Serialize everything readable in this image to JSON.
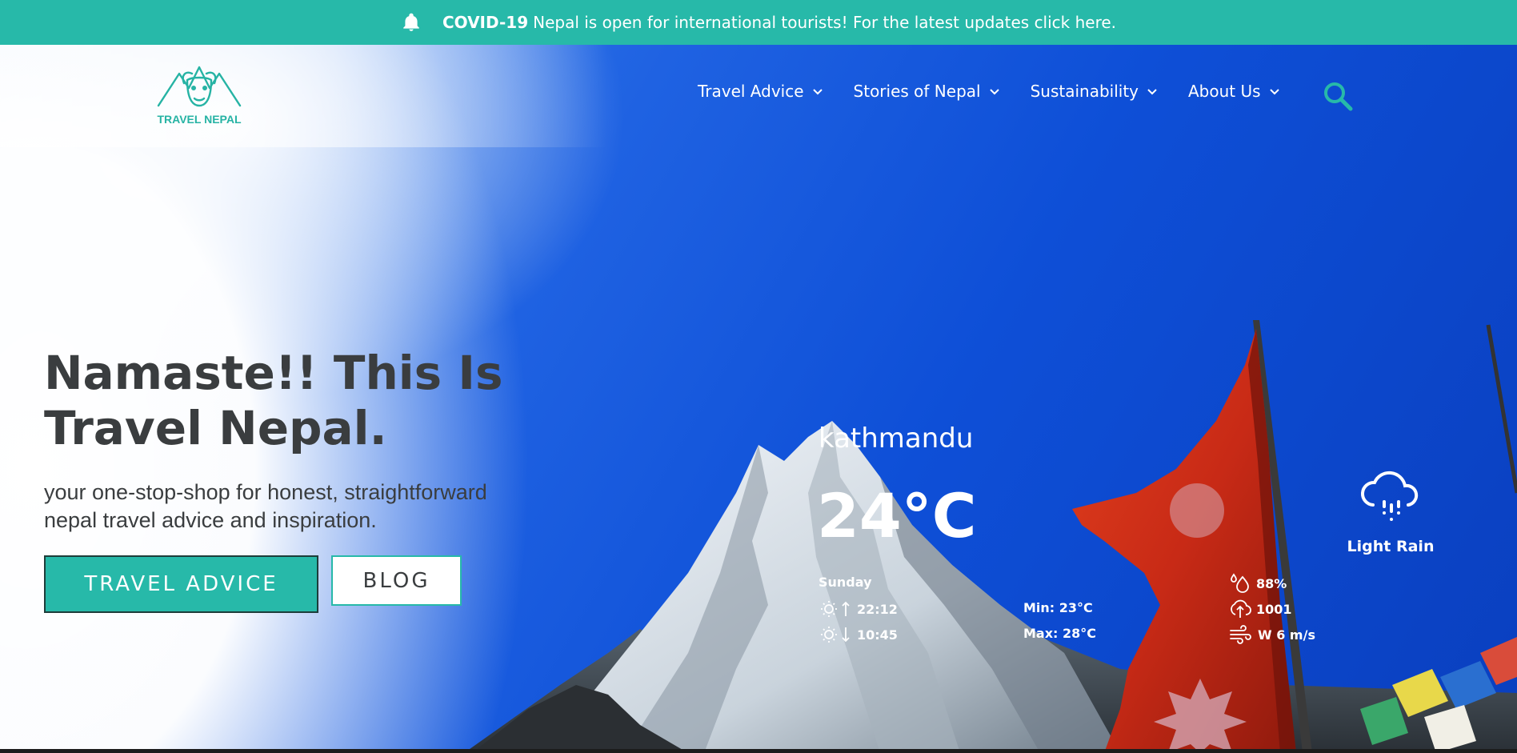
{
  "banner": {
    "bold": "COVID-19",
    "text": "Nepal is open for international tourists! For the latest updates click here.",
    "icon": "bell-icon",
    "bg_color": "#27b9a9"
  },
  "header": {
    "logo_text": "TRAVEL NEPAL",
    "nav": [
      {
        "label": "Travel Advice"
      },
      {
        "label": "Stories of Nepal"
      },
      {
        "label": "Sustainability"
      },
      {
        "label": "About Us"
      }
    ],
    "search_icon": "search-icon",
    "accent_color": "#27b9a9"
  },
  "hero": {
    "headline_line1": "Namaste!! This Is",
    "headline_line2": "Travel Nepal.",
    "subline_line1": "your one-stop-shop for honest, straightforward",
    "subline_line2": "nepal travel advice and inspiration.",
    "primary_button": "TRAVEL ADVICE",
    "secondary_button": "BLOG"
  },
  "weather": {
    "city": "kathmandu",
    "temperature": "24°C",
    "day": "Sunday",
    "sunrise": "22:12",
    "sunset": "10:45",
    "min": "Min: 23°C",
    "max": "Max: 28°C",
    "humidity": "88%",
    "pressure": "1001",
    "wind": "W 6 m/s",
    "condition": "Light Rain",
    "condition_icon": "rain-cloud-icon"
  }
}
